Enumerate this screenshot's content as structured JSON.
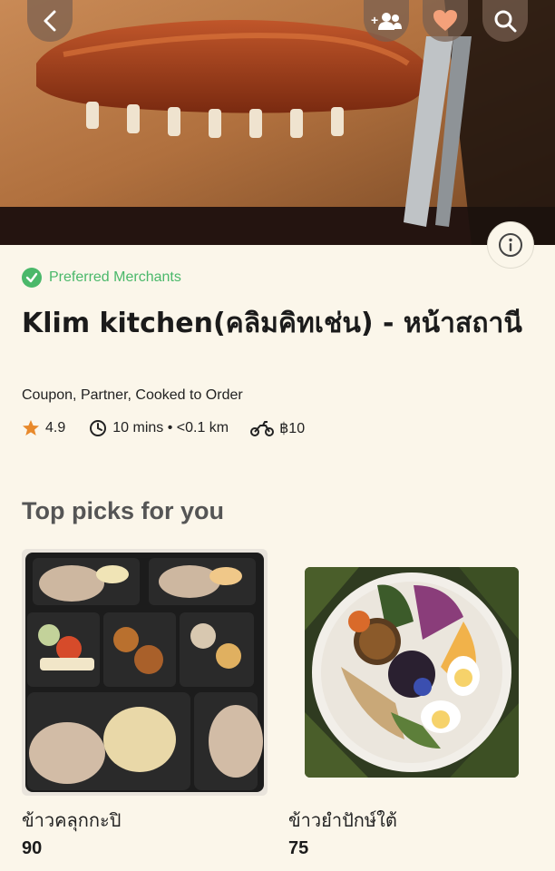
{
  "header": {
    "back_icon": "chevron-left-icon",
    "group_order_icon": "add-group-icon",
    "favorite_icon": "heart-icon",
    "search_icon": "search-icon",
    "info_icon": "info-icon"
  },
  "merchant": {
    "badge_label": "Preferred Merchants",
    "name": "Klim kitchen(คลิมคิทเช่น) - หน้าสถานี",
    "tags": "Coupon, Partner, Cooked to Order",
    "rating": "4.9",
    "time_distance": "10 mins • <0.1 km",
    "delivery_fee": "฿10"
  },
  "section": {
    "title": "Top picks for you"
  },
  "dishes": [
    {
      "name": "ข้าวคลุกกะปิ",
      "price": "90"
    },
    {
      "name": "ข้าวยำปักษ์ใต้",
      "price": "75"
    }
  ],
  "colors": {
    "background": "#fbf6ea",
    "preferred_green": "#4ab86a",
    "rating_star": "#e8892b",
    "heart": "#f4a17a"
  }
}
